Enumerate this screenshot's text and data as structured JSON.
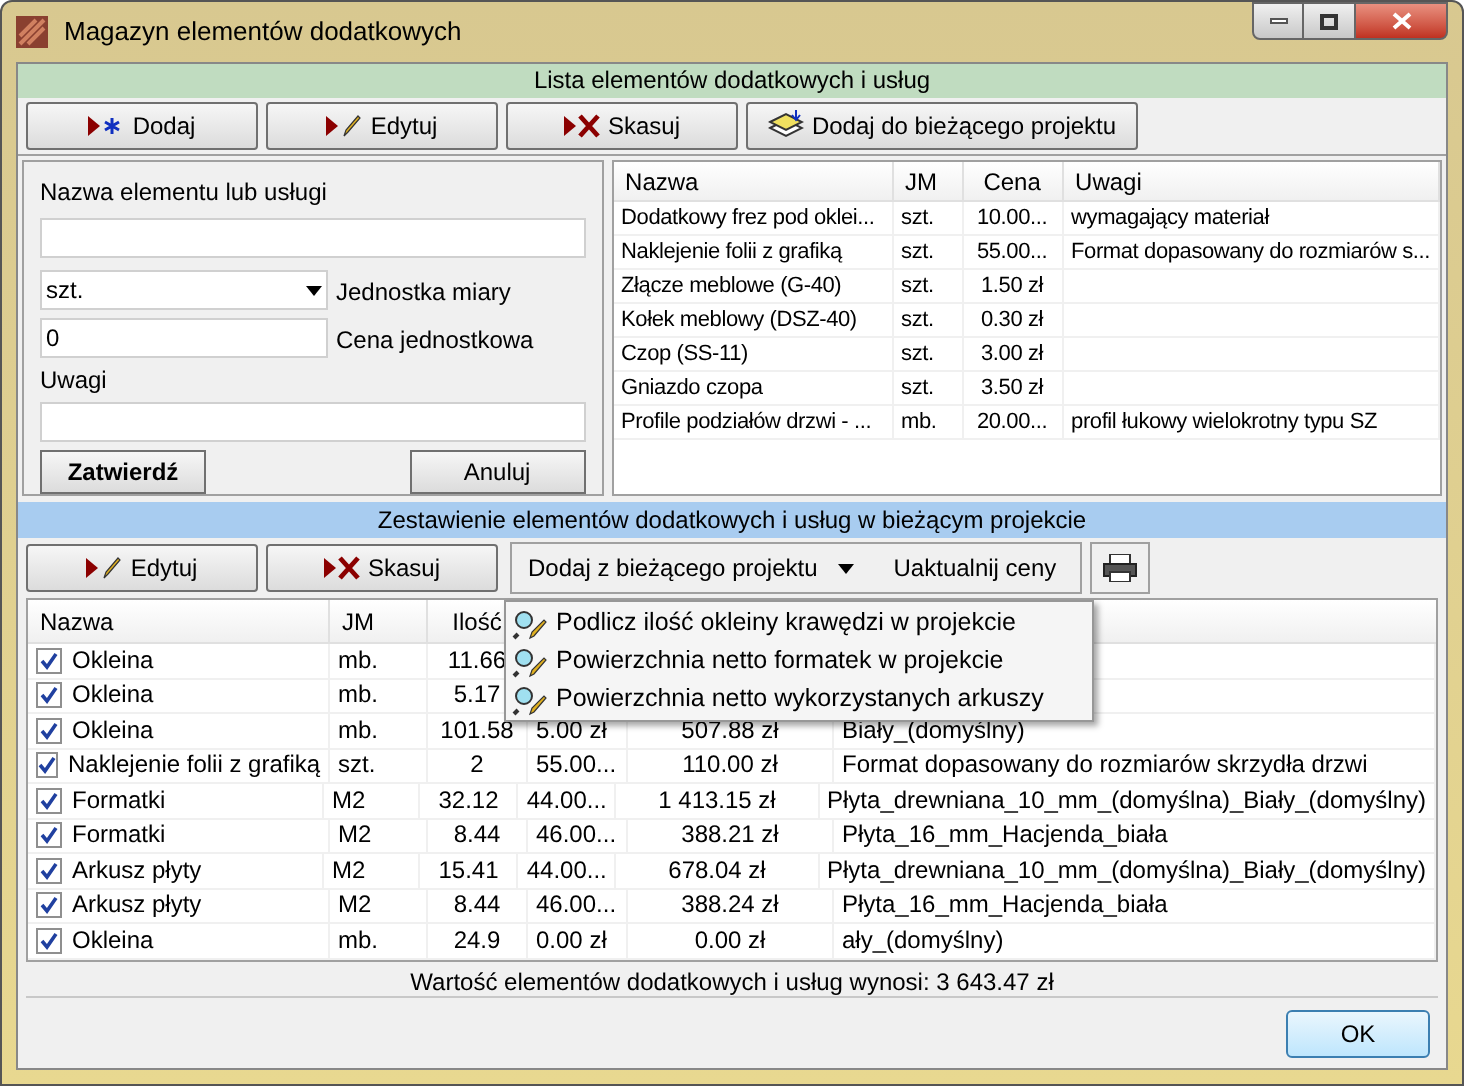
{
  "window": {
    "title": "Magazyn elementów dodatkowych"
  },
  "catalog": {
    "header": "Lista elementów dodatkowych i usług",
    "buttons": [
      {
        "kind": "add",
        "label": "Dodaj"
      },
      {
        "kind": "edit",
        "label": "Edytuj"
      },
      {
        "kind": "delete",
        "label": "Skasuj"
      },
      {
        "kind": "stack",
        "label": "Dodaj do bieżącego projektu"
      }
    ],
    "form": {
      "name_label": "Nazwa elementu lub usługi",
      "unit_value": "szt.",
      "unit_label": "Jednostka miary",
      "price_value": "0",
      "price_label": "Cena jednostkowa",
      "notes_label": "Uwagi",
      "confirm": "Zatwierdź",
      "cancel": "Anuluj"
    },
    "table": {
      "columns": [
        "Nazwa",
        "JM",
        "Cena",
        "Uwagi"
      ],
      "rows": [
        [
          "Dodatkowy frez pod oklei...",
          "szt.",
          "10.00...",
          "wymagający materiał"
        ],
        [
          "Naklejenie folii z grafiką",
          "szt.",
          "55.00...",
          "Format dopasowany do rozmiarów s..."
        ],
        [
          "Złącze meblowe (G-40)",
          "szt.",
          "1.50 zł",
          ""
        ],
        [
          "Kołek meblowy (DSZ-40)",
          "szt.",
          "0.30 zł",
          ""
        ],
        [
          "Czop (SS-11)",
          "szt.",
          "3.00 zł",
          ""
        ],
        [
          "Gniazdo czopa",
          "szt.",
          "3.50 zł",
          ""
        ],
        [
          "Profile podziałów drzwi - ...",
          "mb.",
          "20.00...",
          "profil łukowy wielokrotny typu SZ"
        ]
      ]
    }
  },
  "project": {
    "header": "Zestawienie elementów dodatkowych i usług w bieżącym projekcie",
    "buttons": [
      {
        "kind": "edit",
        "label": "Edytuj"
      },
      {
        "kind": "delete",
        "label": "Skasuj"
      }
    ],
    "dropdown_button": "Dodaj z bieżącego projektu",
    "update_button": "Uaktualnij ceny",
    "menu": [
      "Podlicz ilość okleiny krawędzi w projekcie",
      "Powierzchnia netto formatek w projekcie",
      "Powierzchnia netto wykorzystanych arkuszy"
    ],
    "table": {
      "columns": [
        "Nazwa",
        "JM",
        "Ilość"
      ],
      "rows": [
        {
          "checked": true,
          "cells": [
            "Okleina",
            "mb.",
            "11.66"
          ]
        },
        {
          "checked": true,
          "cells": [
            "Okleina",
            "mb.",
            "5.17"
          ]
        },
        {
          "checked": true,
          "cells": [
            "Okleina",
            "mb.",
            "101.58",
            "5.00 zł",
            "507.88 zł",
            "Biały_(domyślny)"
          ]
        },
        {
          "checked": true,
          "cells": [
            "Naklejenie folii z grafiką",
            "szt.",
            "2",
            "55.00...",
            "110.00 zł",
            "Format dopasowany do rozmiarów skrzydła drzwi"
          ]
        },
        {
          "checked": true,
          "cells": [
            "Formatki",
            "M2",
            "32.12",
            "44.00...",
            "1 413.15 zł",
            "Płyta_drewniana_10_mm_(domyślna)_Biały_(domyślny)"
          ]
        },
        {
          "checked": true,
          "cells": [
            "Formatki",
            "M2",
            "8.44",
            "46.00...",
            "388.21 zł",
            "Płyta_16_mm_Hacjenda_biała"
          ]
        },
        {
          "checked": true,
          "cells": [
            "Arkusz płyty",
            "M2",
            "15.41",
            "44.00...",
            "678.04 zł",
            "Płyta_drewniana_10_mm_(domyślna)_Biały_(domyślny)"
          ]
        },
        {
          "checked": true,
          "cells": [
            "Arkusz płyty",
            "M2",
            "8.44",
            "46.00...",
            "388.24 zł",
            "Płyta_16_mm_Hacjenda_biała"
          ]
        },
        {
          "checked": true,
          "cells": [
            "Okleina",
            "mb.",
            "24.9",
            "0.00 zł",
            "0.00 zł",
            "ały_(domyślny)"
          ]
        }
      ]
    },
    "total": "Wartość elementów dodatkowych i usług wynosi: 3 643.47 zł"
  },
  "ok_button": "OK"
}
